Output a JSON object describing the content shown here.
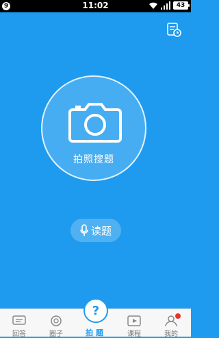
{
  "status_bar": {
    "left_badge": "9",
    "time": "11:02",
    "battery": "43"
  },
  "main": {
    "camera_label": "拍照搜题",
    "read_label": "读题"
  },
  "tabs": [
    {
      "label": "回答",
      "icon": "chat-icon"
    },
    {
      "label": "圈子",
      "icon": "circle-icon"
    },
    {
      "label": "拍题",
      "icon": "question-icon",
      "active": true
    },
    {
      "label": "课程",
      "icon": "play-icon"
    },
    {
      "label": "我的",
      "icon": "user-icon",
      "badge": true
    }
  ],
  "colors": {
    "background": "#1E9BEF",
    "tab_active": "#1E9BEF",
    "badge": "#E6372A"
  }
}
